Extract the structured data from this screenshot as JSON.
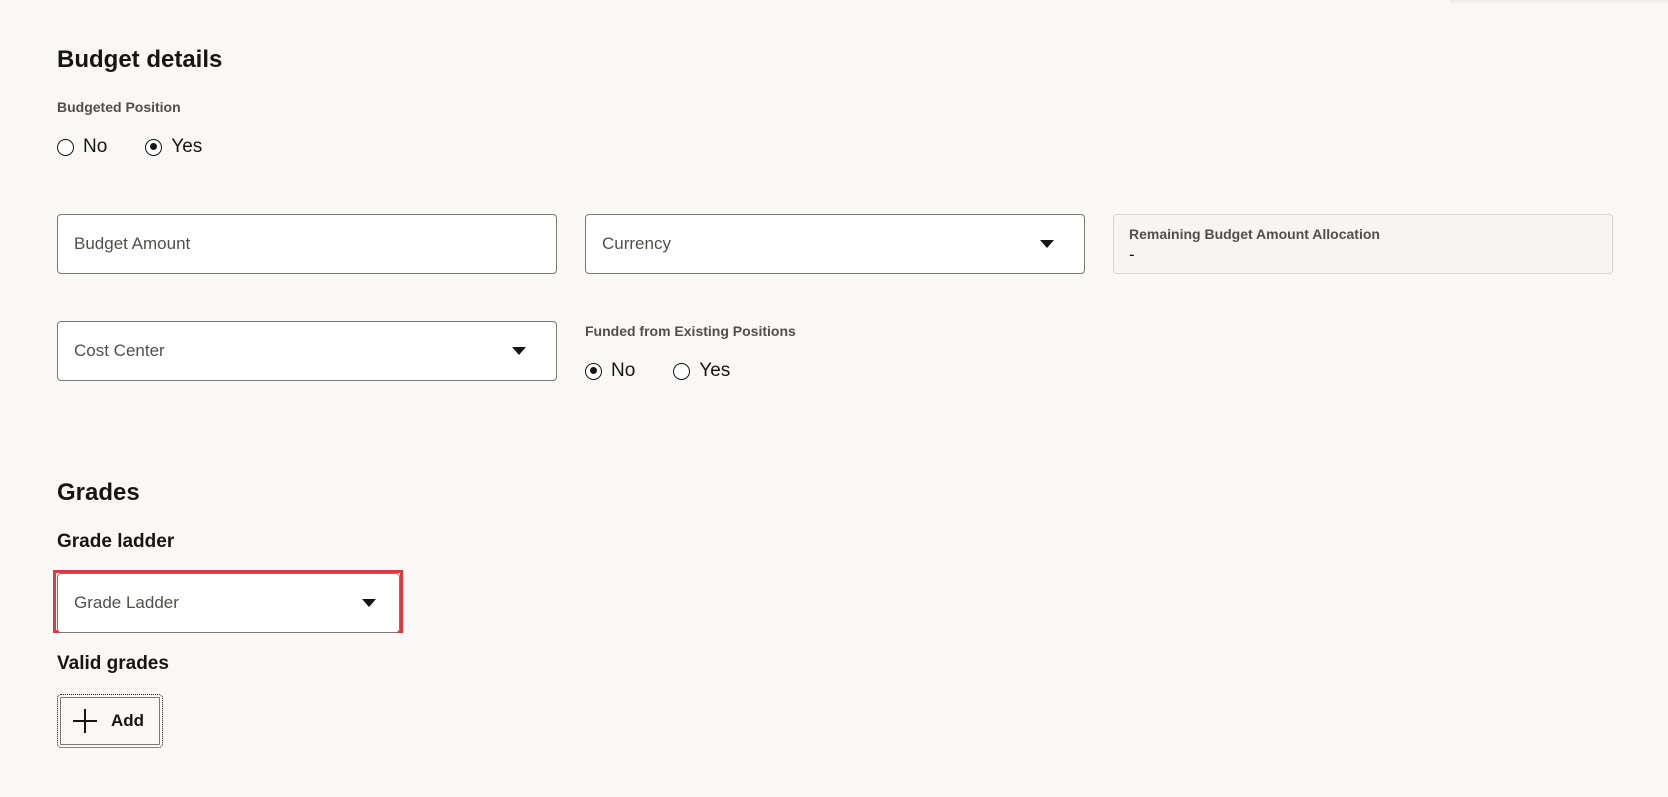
{
  "budget_details": {
    "title": "Budget details",
    "budgeted_position": {
      "label": "Budgeted Position",
      "options": [
        {
          "label": "No",
          "checked": false
        },
        {
          "label": "Yes",
          "checked": true
        }
      ]
    },
    "budget_amount": {
      "placeholder": "Budget Amount"
    },
    "currency": {
      "placeholder": "Currency"
    },
    "remaining_budget": {
      "label": "Remaining Budget Amount Allocation",
      "value": "-"
    },
    "cost_center": {
      "placeholder": "Cost Center"
    },
    "funded_from_existing": {
      "label": "Funded from Existing Positions",
      "options": [
        {
          "label": "No",
          "checked": true
        },
        {
          "label": "Yes",
          "checked": false
        }
      ]
    }
  },
  "grades": {
    "title": "Grades",
    "grade_ladder_heading": "Grade ladder",
    "grade_ladder_select": {
      "placeholder": "Grade Ladder"
    },
    "valid_grades_heading": "Valid grades",
    "add_button_label": "Add"
  },
  "colors": {
    "background": "#f9f8f6",
    "highlight": "#e3373d",
    "text": "#161513"
  }
}
